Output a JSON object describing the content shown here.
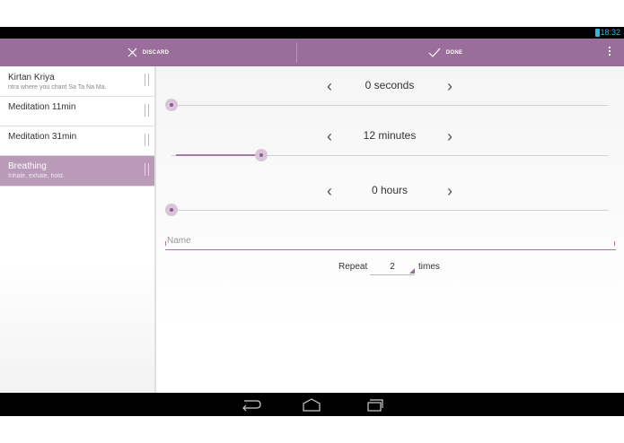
{
  "status_bar": {
    "time": "18:32",
    "accent_color": "#33b5e5"
  },
  "action_bar": {
    "discard_label": "DISCARD",
    "done_label": "DONE",
    "color": "#9a6e9a"
  },
  "sidebar": {
    "items": [
      {
        "title": "Kirtan Kriya",
        "subtitle": "ntra where you chant Sa Ta Na Ma."
      },
      {
        "title": "Meditation 11min",
        "subtitle": ""
      },
      {
        "title": "Meditation 31min",
        "subtitle": ""
      },
      {
        "title": "Breathing",
        "subtitle": "Inhale, exhale, hold."
      }
    ],
    "selected_index": 3
  },
  "editor": {
    "seconds": {
      "value": "0 seconds",
      "level": 0.0
    },
    "minutes": {
      "value": "12 minutes",
      "level": 0.2
    },
    "hours": {
      "value": "0 hours",
      "level": 0.0
    },
    "name_placeholder": "Name",
    "repeat": {
      "label_before": "Repeat",
      "count": "2",
      "label_after": "times"
    }
  },
  "icons": {
    "discard": "close-icon",
    "done": "checkmark-icon",
    "overflow": "overflow-menu-icon",
    "back": "back-icon",
    "home": "home-icon",
    "recents": "recents-icon",
    "battery": "battery-icon",
    "prev": "chevron-left-icon",
    "next": "chevron-right-icon"
  }
}
